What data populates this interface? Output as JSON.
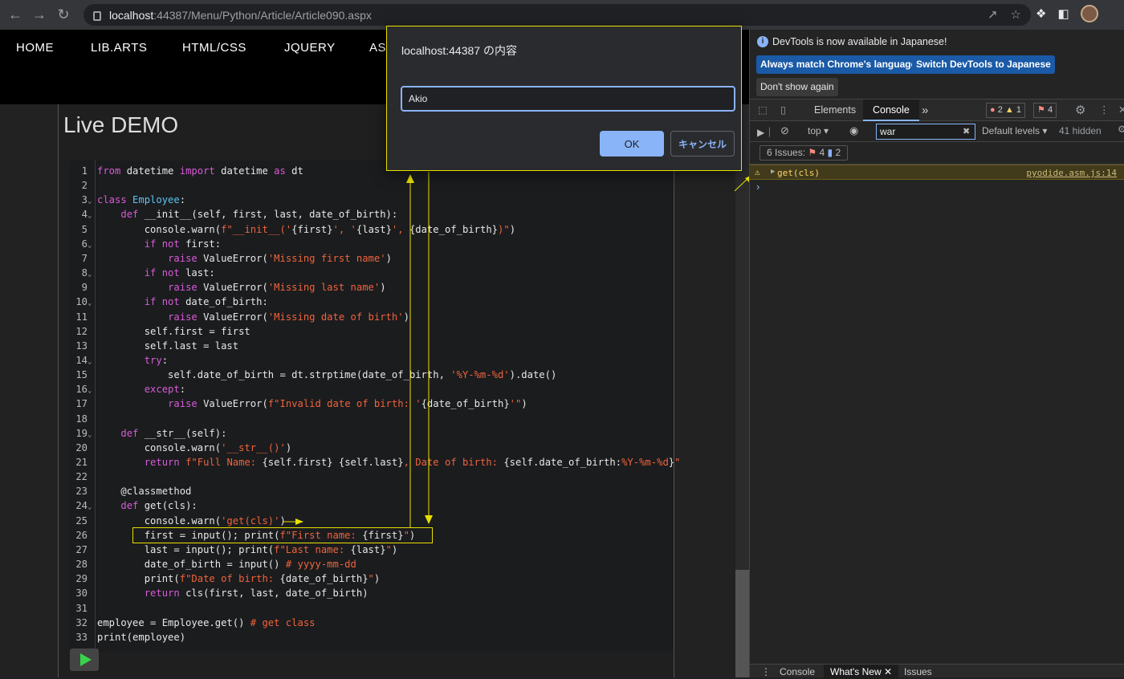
{
  "browser": {
    "url_host": "localhost",
    "url_path": ":44387/Menu/Python/Article/Article090.aspx"
  },
  "site_nav": [
    "HOME",
    "LIB.ARTS",
    "HTML/CSS",
    "JQUERY",
    "ASP"
  ],
  "page_title": "Live DEMO",
  "code_lines": [
    {
      "n": "1",
      "fold": false,
      "html": "<span class=\"kw\">from</span> datetime <span class=\"kw\">import</span> datetime <span class=\"kw\">as</span> dt"
    },
    {
      "n": "2",
      "fold": false,
      "html": ""
    },
    {
      "n": "3",
      "fold": true,
      "html": "<span class=\"kw\">class</span> <span class=\"fn\">Employee</span>:"
    },
    {
      "n": "4",
      "fold": true,
      "html": "    <span class=\"kw\">def</span> __init__(self, first, last, date_of_birth):"
    },
    {
      "n": "5",
      "fold": false,
      "html": "        console.warn(<span class=\"str\">f\"__init__('</span>{first}<span class=\"str\">', '</span>{last}<span class=\"str\">', </span>{date_of_birth}<span class=\"str\">)\"</span>)"
    },
    {
      "n": "6",
      "fold": true,
      "html": "        <span class=\"kw\">if not</span> first:"
    },
    {
      "n": "7",
      "fold": false,
      "html": "            <span class=\"kw\">raise</span> ValueError(<span class=\"str\">'Missing first name'</span>)"
    },
    {
      "n": "8",
      "fold": true,
      "html": "        <span class=\"kw\">if not</span> last:"
    },
    {
      "n": "9",
      "fold": false,
      "html": "            <span class=\"kw\">raise</span> ValueError(<span class=\"str\">'Missing last name'</span>)"
    },
    {
      "n": "10",
      "fold": true,
      "html": "        <span class=\"kw\">if not</span> date_of_birth:"
    },
    {
      "n": "11",
      "fold": false,
      "html": "            <span class=\"kw\">raise</span> ValueError(<span class=\"str\">'Missing date of birth'</span>)"
    },
    {
      "n": "12",
      "fold": false,
      "html": "        self.first = first"
    },
    {
      "n": "13",
      "fold": false,
      "html": "        self.last = last"
    },
    {
      "n": "14",
      "fold": true,
      "html": "        <span class=\"kw\">try</span>:"
    },
    {
      "n": "15",
      "fold": false,
      "html": "            self.date_of_birth = dt.strptime(date_of_birth, <span class=\"str\">'%Y-%m-%d'</span>).date()"
    },
    {
      "n": "16",
      "fold": true,
      "html": "        <span class=\"kw\">except</span>:"
    },
    {
      "n": "17",
      "fold": false,
      "html": "            <span class=\"kw\">raise</span> ValueError(<span class=\"str\">f\"Invalid date of birth: '</span>{date_of_birth}<span class=\"str\">'\"</span>)"
    },
    {
      "n": "18",
      "fold": false,
      "html": ""
    },
    {
      "n": "19",
      "fold": true,
      "html": "    <span class=\"kw\">def</span> __str__(self):"
    },
    {
      "n": "20",
      "fold": false,
      "html": "        console.warn(<span class=\"str\">'__str__()'</span>)"
    },
    {
      "n": "21",
      "fold": false,
      "html": "        <span class=\"kw\">return</span> <span class=\"str\">f\"Full Name: </span>{self.first} {self.last}<span class=\"str\">, Date of birth: </span>{self.date_of_birth:<span class=\"str\">%Y-%m-%d</span>}<span class=\"str\">\"</span>"
    },
    {
      "n": "22",
      "fold": false,
      "html": ""
    },
    {
      "n": "23",
      "fold": false,
      "html": "    @classmethod"
    },
    {
      "n": "24",
      "fold": true,
      "html": "    <span class=\"kw\">def</span> get(cls):"
    },
    {
      "n": "25",
      "fold": false,
      "html": "        console.warn(<span class=\"str\">'get(cls)'</span>)"
    },
    {
      "n": "26",
      "fold": false,
      "html": "        first = input(); print(<span class=\"str\">f\"First name: </span>{first}<span class=\"str\">\"</span>)"
    },
    {
      "n": "27",
      "fold": false,
      "html": "        last = input(); print(<span class=\"str\">f\"Last name: </span>{last}<span class=\"str\">\"</span>)"
    },
    {
      "n": "28",
      "fold": false,
      "html": "        date_of_birth = input() <span class=\"cm\"># yyyy-mm-dd</span>"
    },
    {
      "n": "29",
      "fold": false,
      "html": "        print(<span class=\"str\">f\"Date of birth: </span>{date_of_birth}<span class=\"str\">\"</span>)"
    },
    {
      "n": "30",
      "fold": false,
      "html": "        <span class=\"kw\">return</span> cls(first, last, date_of_birth)"
    },
    {
      "n": "31",
      "fold": false,
      "html": ""
    },
    {
      "n": "32",
      "fold": false,
      "html": "employee = Employee.get() <span class=\"cm\"># get class</span>"
    },
    {
      "n": "33",
      "fold": false,
      "html": "print(employee)"
    }
  ],
  "dialog": {
    "title": "localhost:44387 の内容",
    "input_value": "Akio",
    "ok_label": "OK",
    "cancel_label": "キャンセル"
  },
  "devtools": {
    "info_text": "DevTools is now available in Japanese!",
    "btn_match": "Always match Chrome's language",
    "btn_switch": "Switch DevTools to Japanese",
    "btn_dont_show": "Don't show again",
    "tab_elements": "Elements",
    "tab_console": "Console",
    "tab_more": "»",
    "err_count": "2",
    "warn_count": "1",
    "issue_count": "4",
    "context": "top",
    "filter_value": "war",
    "levels": "Default levels",
    "hidden": "41 hidden",
    "issues_label": "6 Issues:",
    "issues_err": "4",
    "issues_info": "2",
    "warn_message": "get(cls)",
    "warn_source": "pyodide.asm.js:14",
    "drawer_tabs": [
      "Console",
      "What's New",
      "Issues"
    ]
  },
  "colors": {
    "highlight": "#e8e000",
    "accent": "#8ab4f8"
  }
}
